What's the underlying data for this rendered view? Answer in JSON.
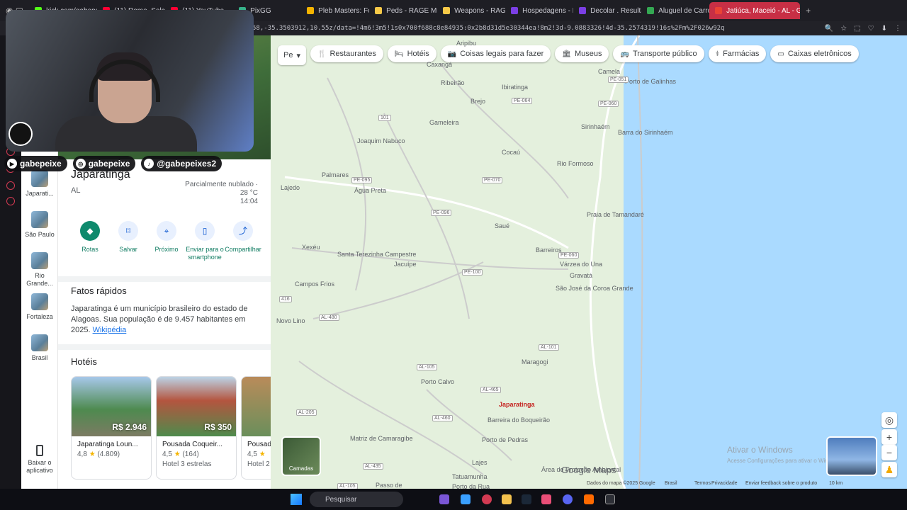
{
  "browser": {
    "tabs": [
      {
        "label": "kick.com/gabepei",
        "color": "#53fc18"
      },
      {
        "label": "(11) Rome, Solar...",
        "color": "#ff0033"
      },
      {
        "label": "(11) YouTube",
        "color": "#ff0033"
      },
      {
        "label": "PixGG",
        "color": "#37b28a"
      },
      {
        "label": "Pleb Masters: Fo",
        "color": "#f5b400"
      },
      {
        "label": "Peds - RAGE Mult",
        "color": "#f7c948"
      },
      {
        "label": "Weapons - RAGE",
        "color": "#f7c948"
      },
      {
        "label": "Hospedagens - D",
        "color": "#7b3fe4"
      },
      {
        "label": "Decolar . Resultad",
        "color": "#7b3fe4"
      },
      {
        "label": "Aluguel de Carro",
        "color": "#34a853"
      },
      {
        "label": "Jatiúca, Maceió - AL - Go",
        "color": "#ea4335",
        "active": true
      }
    ],
    "new_tab": "+",
    "url": "58,-35.3503912,10.55z/data=!4m6!3m5!1s0x700f688c8e84935:0x2b8d31d5e30344ea!8m2!3d-9.0883326!4d-35.2574319!16s%2Fm%2F026w92q"
  },
  "overlay": {
    "socials": [
      {
        "icon": "youtube",
        "label": "gabepeixe"
      },
      {
        "icon": "instagram",
        "label": "gabepeixe"
      },
      {
        "icon": "tiktok",
        "label": "@gabepeixes2"
      }
    ]
  },
  "places": [
    {
      "label": "Japarati..."
    },
    {
      "label": "São Paulo"
    },
    {
      "label": "Rio Grande..."
    },
    {
      "label": "Fortaleza"
    },
    {
      "label": "Brasil"
    }
  ],
  "app_install": {
    "label": "Baixar o aplicativo"
  },
  "panel": {
    "title": "Japaratinga",
    "subtitle": "AL",
    "weather": {
      "desc": "Parcialmente nublado ·",
      "temp": "28 °C",
      "time": "14:04"
    },
    "actions": [
      {
        "label": "Rotas",
        "icon": "directions-icon"
      },
      {
        "label": "Salvar",
        "icon": "bookmark-icon"
      },
      {
        "label": "Próximo",
        "icon": "nearby-icon"
      },
      {
        "label": "Enviar para o smartphone",
        "icon": "send-to-phone-icon"
      },
      {
        "label": "Compartilhar",
        "icon": "share-icon"
      }
    ],
    "facts_title": "Fatos rápidos",
    "facts_text": "Japaratinga é um município brasileiro do estado de Alagoas. Sua população é de 9.457 habitantes em 2025.",
    "facts_link": "Wikipédia",
    "hotels_title": "Hotéis",
    "hotels": [
      {
        "name": "Japaratinga Loun...",
        "price": "R$ 2.946",
        "rating": "4,8",
        "reviews": "(4.809)",
        "extra": ""
      },
      {
        "name": "Pousada Coqueir...",
        "price": "R$ 350",
        "rating": "4,5",
        "reviews": "(164)",
        "extra": "Hotel 3 estrelas"
      },
      {
        "name": "Pousad",
        "price": "",
        "rating": "4,5",
        "reviews": "",
        "extra": "Hotel 2"
      }
    ]
  },
  "map": {
    "search_placeholder": "Pe",
    "chips": [
      {
        "label": "Restaurantes",
        "icon": "fork-icon"
      },
      {
        "label": "Hotéis",
        "icon": "bed-icon"
      },
      {
        "label": "Coisas legais para fazer",
        "icon": "camera-icon"
      },
      {
        "label": "Museus",
        "icon": "museum-icon"
      },
      {
        "label": "Transporte público",
        "icon": "bus-icon"
      },
      {
        "label": "Farmácias",
        "icon": "pharmacy-icon"
      },
      {
        "label": "Caixas eletrônicos",
        "icon": "atm-icon"
      }
    ],
    "labels": [
      {
        "t": "Aripibu"
      },
      {
        "t": "Caxangá"
      },
      {
        "t": "Camela"
      },
      {
        "t": "Porto de Galinhas"
      },
      {
        "t": "Ribeirão"
      },
      {
        "t": "Ibiratinga"
      },
      {
        "t": "Brejo"
      },
      {
        "t": "Gameleira"
      },
      {
        "t": "Sirinhaém"
      },
      {
        "t": "Barra do Sirinhaém"
      },
      {
        "t": "Joaquim Nabuco"
      },
      {
        "t": "Cocaú"
      },
      {
        "t": "Rio Formoso"
      },
      {
        "t": "Palmares"
      },
      {
        "t": "Lajedo"
      },
      {
        "t": "Água Preta"
      },
      {
        "t": "Praia de Tamandaré"
      },
      {
        "t": "Saué"
      },
      {
        "t": "Xexéu"
      },
      {
        "t": "Barreiros"
      },
      {
        "t": "Santa Terezinha Campestre"
      },
      {
        "t": "Jacuípe"
      },
      {
        "t": "Várzea do Una"
      },
      {
        "t": "Gravatá"
      },
      {
        "t": "Campos Frios"
      },
      {
        "t": "São José da Coroa Grande"
      },
      {
        "t": "Novo Lino"
      },
      {
        "t": "Maragogi"
      },
      {
        "t": "Porto Calvo"
      },
      {
        "t": "Japaratinga"
      },
      {
        "t": "Barreira do Boqueirão"
      },
      {
        "t": "Matriz de Camaragibe"
      },
      {
        "t": "Porto de Pedras"
      },
      {
        "t": "Lajes"
      },
      {
        "t": "Tatuamunha"
      },
      {
        "t": "Passo de"
      },
      {
        "t": "Porto da Rua"
      },
      {
        "t": "Área de Proteção Ambiental"
      }
    ],
    "roads": [
      "PE-051",
      "PE-064",
      "PE-060",
      "101",
      "PE-095",
      "PE-070",
      "PE-096",
      "PE-060",
      "PE-100",
      "416",
      "AL-480",
      "AL-101",
      "AL-105",
      "AL-465",
      "AL-205",
      "AL-460",
      "AL-435",
      "AL-105"
    ],
    "layers_label": "Camadas",
    "brand": "Google Maps",
    "footer": [
      "Dados do mapa ©2025 Google",
      "Brasil",
      "Termos",
      "Privacidade",
      "Enviar feedback sobre o produto",
      "10 km"
    ],
    "watermark_title": "Ativar o Windows",
    "watermark_sub": "Acesse Configurações para ativar o Windows."
  },
  "taskbar": {
    "search_placeholder": "Pesquisar"
  }
}
